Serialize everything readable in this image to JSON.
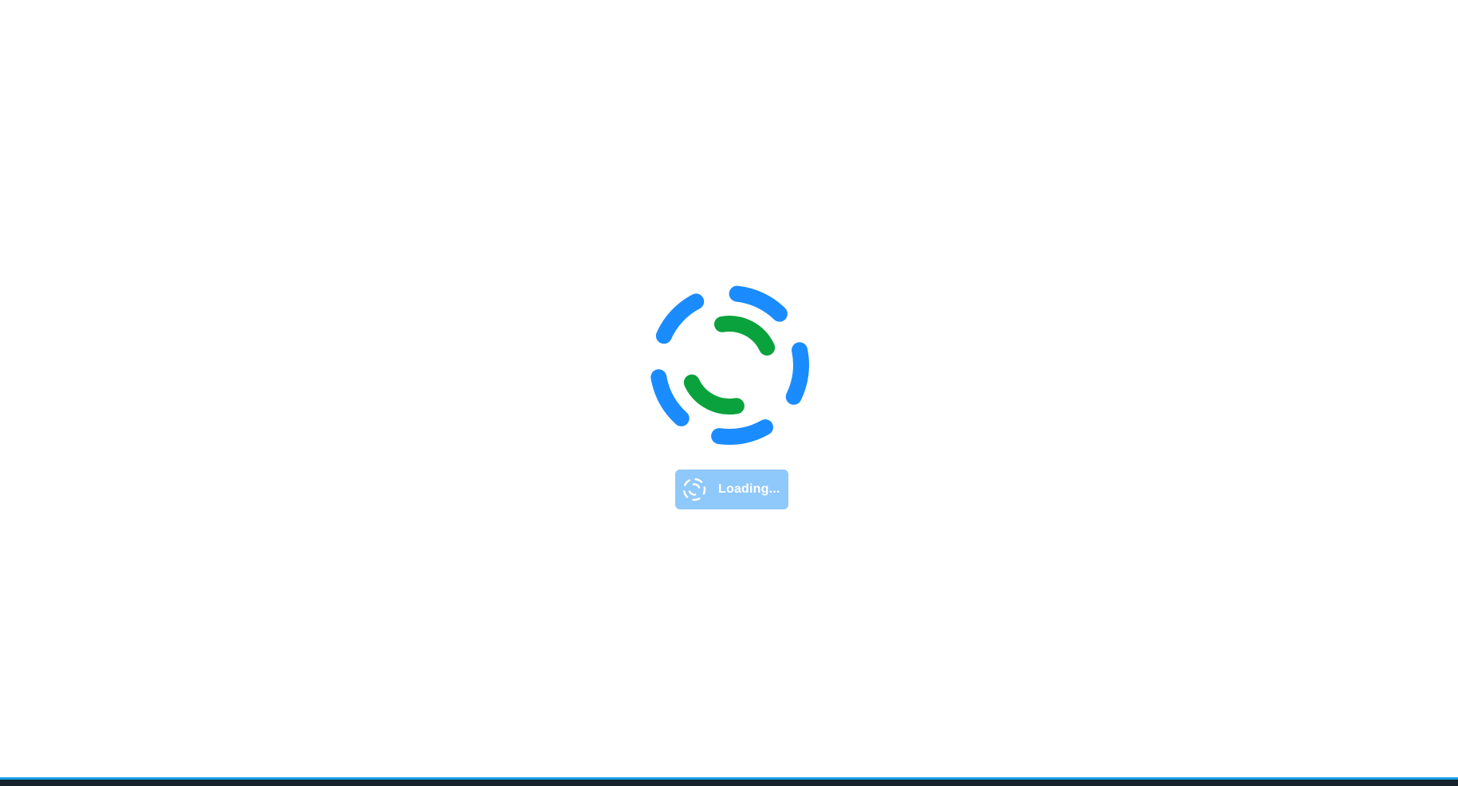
{
  "loader": {
    "button_label": "Loading...",
    "spinner_icon": "spinner-icon",
    "colors": {
      "outer_ring": "#1a8cff",
      "inner_ring": "#0aa23d",
      "button_bg": "#8fc8fb",
      "button_text": "#ffffff"
    }
  },
  "footer": {
    "accent_color": "#1aa3e8",
    "background": "#16222c"
  }
}
